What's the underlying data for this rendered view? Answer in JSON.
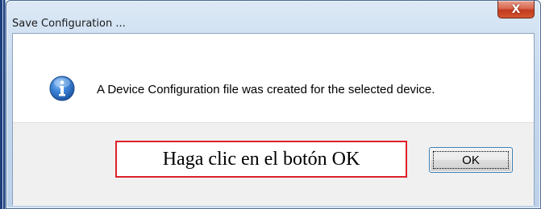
{
  "window": {
    "title": "Save Configuration ...",
    "close_glyph": "X"
  },
  "dialog": {
    "icon": "info-icon",
    "message": "A Device Configuration file was created for the selected device."
  },
  "annotation": {
    "text": "Haga clic en el botón OK",
    "border_color": "#e0202a"
  },
  "buttons": {
    "ok_label": "OK"
  },
  "colors": {
    "info_icon_blue": "#2a6fc9",
    "close_button_red": "#c23b1f",
    "titlebar": "#c4d8ee",
    "footer": "#f0f0f0"
  }
}
